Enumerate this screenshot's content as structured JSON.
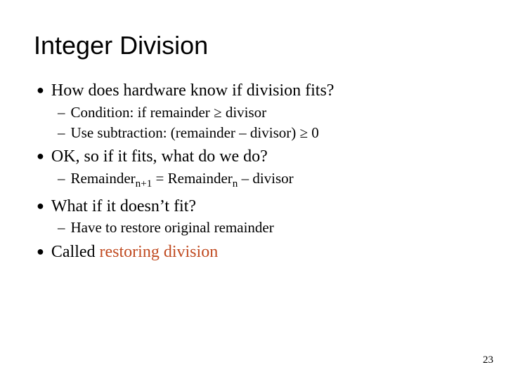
{
  "title": "Integer Division",
  "bullets": {
    "b1_1": "How does hardware know if division fits?",
    "b1_1_s1": "Condition: if remainder ≥ divisor",
    "b1_1_s2": "Use subtraction: (remainder – divisor) ≥ 0",
    "b1_2": "OK, so if it fits, what do we do?",
    "b1_2_s1_pre": "Remainder",
    "b1_2_s1_sub1": "n+1",
    "b1_2_s1_mid": " = Remainder",
    "b1_2_s1_sub2": "n",
    "b1_2_s1_post": " – divisor",
    "b1_3": "What if it doesn’t fit?",
    "b1_3_s1": "Have to restore original remainder",
    "b1_4_pre": "Called ",
    "b1_4_accent": "restoring division"
  },
  "pagenum": "23"
}
